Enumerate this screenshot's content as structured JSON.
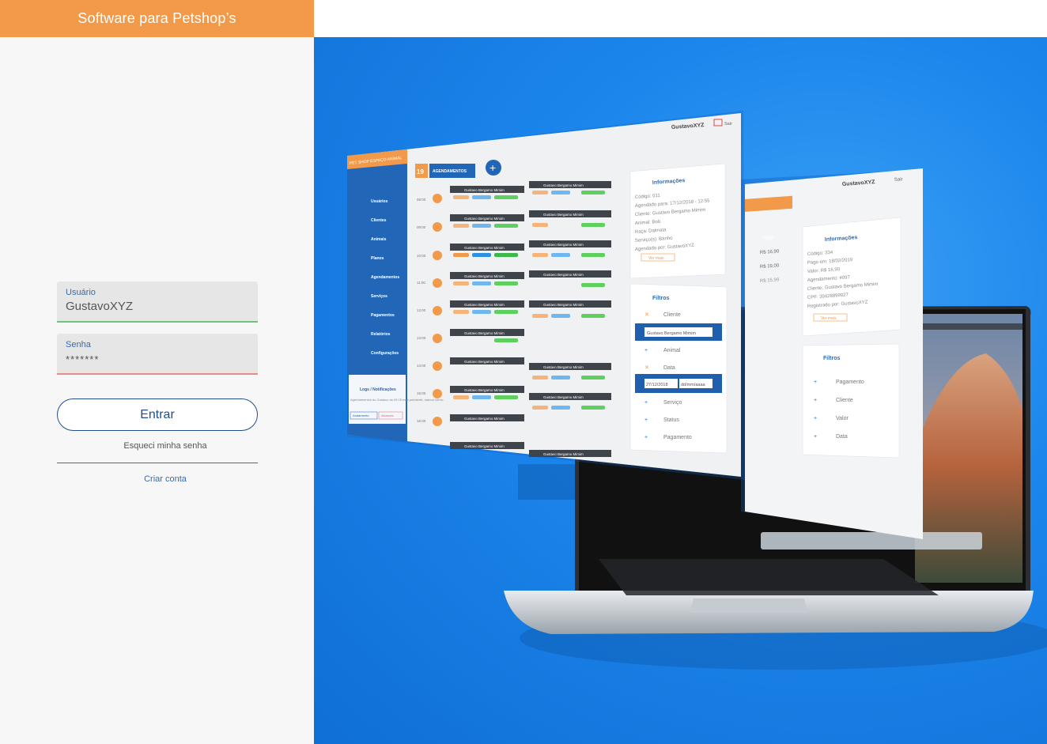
{
  "header": {
    "title": "Software para Petshop’s"
  },
  "login": {
    "user_label": "Usuário",
    "user_value": "GustavoXYZ",
    "pass_label": "Senha",
    "pass_value": "*******",
    "submit_label": "Entrar",
    "forgot_label": "Esqueci minha senha",
    "create_label": "Criar conta"
  },
  "mockup": {
    "brand": "PET SHOP ESPAÇO ANIMAL",
    "user_name": "GustavoXYZ",
    "logout_label": "Sair",
    "day_number": "19",
    "section_title": "AGENDAMENTOS",
    "menu": [
      "Usuários",
      "Clientes",
      "Animais",
      "Planos",
      "Agendamentos",
      "Serviços",
      "Pagamentos",
      "Relatórios",
      "Configurações"
    ],
    "logs": {
      "title": "Logs / Notificações",
      "text": "Agendamentos do Gustavo às 09:25 está pendente, marcar como:",
      "btn_a": "Andamento",
      "btn_b": "Atrasado"
    },
    "times": [
      "08:00",
      "09:00",
      "10:00",
      "11:00",
      "12:00",
      "13:00",
      "14:00",
      "15:00",
      "16:00"
    ],
    "card_name": "Gustavo Bergamo Mimim",
    "info": {
      "title": "Informações",
      "lines": [
        "Código: 011",
        "Agendado para: 17/12/2018 - 12:55",
        "Cliente: Gustavo Bergamo Mimim",
        "Animal: Bob",
        "Raça: Dalmata",
        "Serviço(s): Banho",
        "Agendado por: GustavoXYZ"
      ],
      "more": "Ver mais"
    },
    "filters": {
      "title": "Filtros",
      "items": [
        "Cliente",
        "Animal",
        "Data",
        "Serviço",
        "Status",
        "Pagamento"
      ],
      "client_value": "Gustavo Bergamo Mimim",
      "date_from": "27/12/2018",
      "date_to": "dd/mm/aaaa"
    },
    "second": {
      "user_name": "GustavoXYZ",
      "logout_label": "Sair",
      "col_title": "Valor",
      "values": [
        "R$ 16,90",
        "R$ 19,00",
        "R$ 15,99"
      ],
      "info_title": "Informações",
      "lines": [
        "Código: 334",
        "Pago em: 18/02/2019",
        "Valor: R$ 16,90",
        "Agendamento: #097",
        "Cliente: Gustavo Bergamo Mimim",
        "CPF: 39428899927",
        "Registrado por: GustavoXYZ"
      ],
      "more": "Ver mais",
      "filters_title": "Filtros",
      "filters": [
        "Pagamento",
        "Cliente",
        "Valor",
        "Data"
      ]
    }
  },
  "colors": {
    "orange": "#f29a4a",
    "blue": "#1c86ec",
    "navy": "#1f4f8a"
  }
}
